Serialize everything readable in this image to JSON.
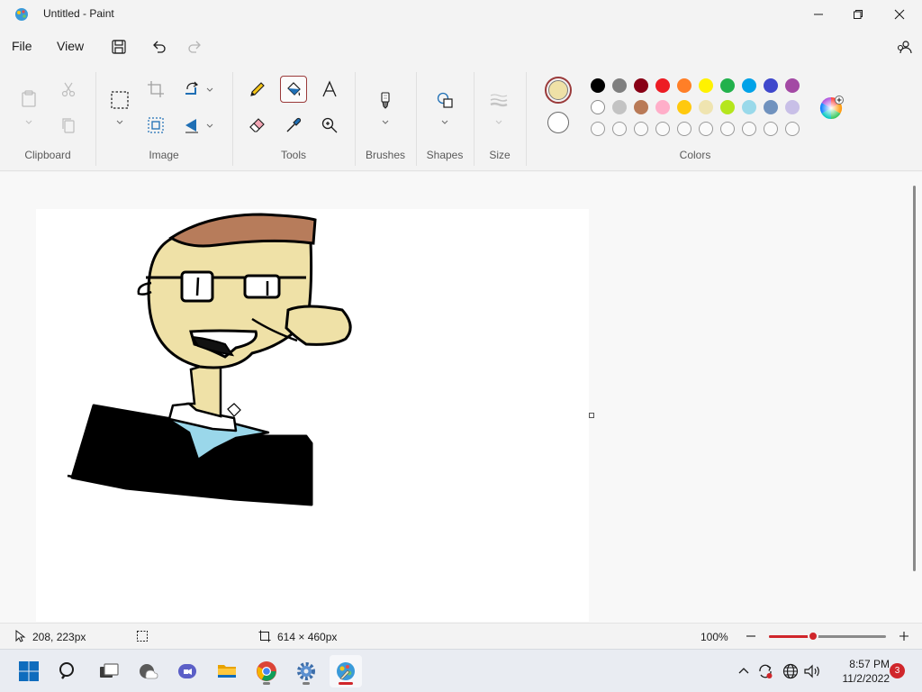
{
  "window": {
    "title": "Untitled - Paint"
  },
  "menu": {
    "file": "File",
    "view": "View"
  },
  "ribbon": {
    "groups": {
      "clipboard": "Clipboard",
      "image": "Image",
      "tools": "Tools",
      "brushes": "Brushes",
      "shapes": "Shapes",
      "size": "Size",
      "colors": "Colors"
    },
    "primary_color": "#efe1a7",
    "secondary_color": "#ffffff",
    "palette_row1": [
      "#000000",
      "#7f7f7f",
      "#880015",
      "#ed1c24",
      "#ff7f27",
      "#fff200",
      "#22b14c",
      "#00a2e8",
      "#3f48cc",
      "#a349a4"
    ],
    "palette_row2": [
      "#ffffff",
      "#c3c3c3",
      "#b97a57",
      "#ffaec9",
      "#ffc90e",
      "#efe4b0",
      "#b5e61d",
      "#99d9ea",
      "#7092be",
      "#c8bfe7"
    ],
    "palette_row3_empty": 10
  },
  "canvas": {
    "skin": "#efe1a7",
    "hair": "#b77c5b",
    "shirt": "#9ad7ea",
    "jacket": "#000000"
  },
  "status": {
    "cursor_pos": "208, 223px",
    "canvas_size": "614 × 460px",
    "zoom": "100%",
    "zoom_fraction": 0.38
  },
  "taskbar": {
    "time": "8:57 PM",
    "date": "11/2/2022",
    "notifications": "3"
  }
}
